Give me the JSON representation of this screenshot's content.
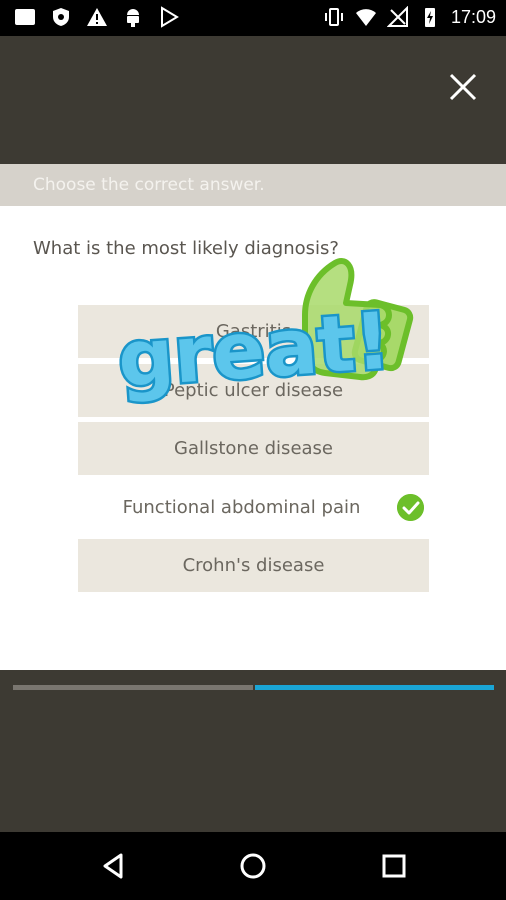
{
  "status_bar": {
    "time": "17:09",
    "icons": [
      "gallery-icon",
      "shield-icon",
      "warning-icon",
      "android-icon",
      "play-store-icon",
      "vibrate-icon",
      "wifi-icon",
      "no-signal-icon",
      "battery-charging-icon"
    ]
  },
  "header": {
    "instruction": "Choose the correct answer."
  },
  "quiz": {
    "question": "What is the most likely diagnosis?",
    "options": [
      {
        "label": "Gastritis"
      },
      {
        "label": "Peptic ulcer disease"
      },
      {
        "label": "Gallstone disease"
      },
      {
        "label": "Functional abdominal pain",
        "correct": true
      },
      {
        "label": "Crohn's disease"
      }
    ]
  },
  "feedback": {
    "text": "great!"
  },
  "progress": {
    "completed_fraction": 0.5
  },
  "colors": {
    "accent": "#1aa5d6",
    "correct": "#6cbf2a",
    "background": "#3d3a33",
    "option_bg": "#ebe7de"
  },
  "navigation": {
    "icons": [
      "back-icon",
      "home-icon",
      "recents-icon"
    ]
  }
}
